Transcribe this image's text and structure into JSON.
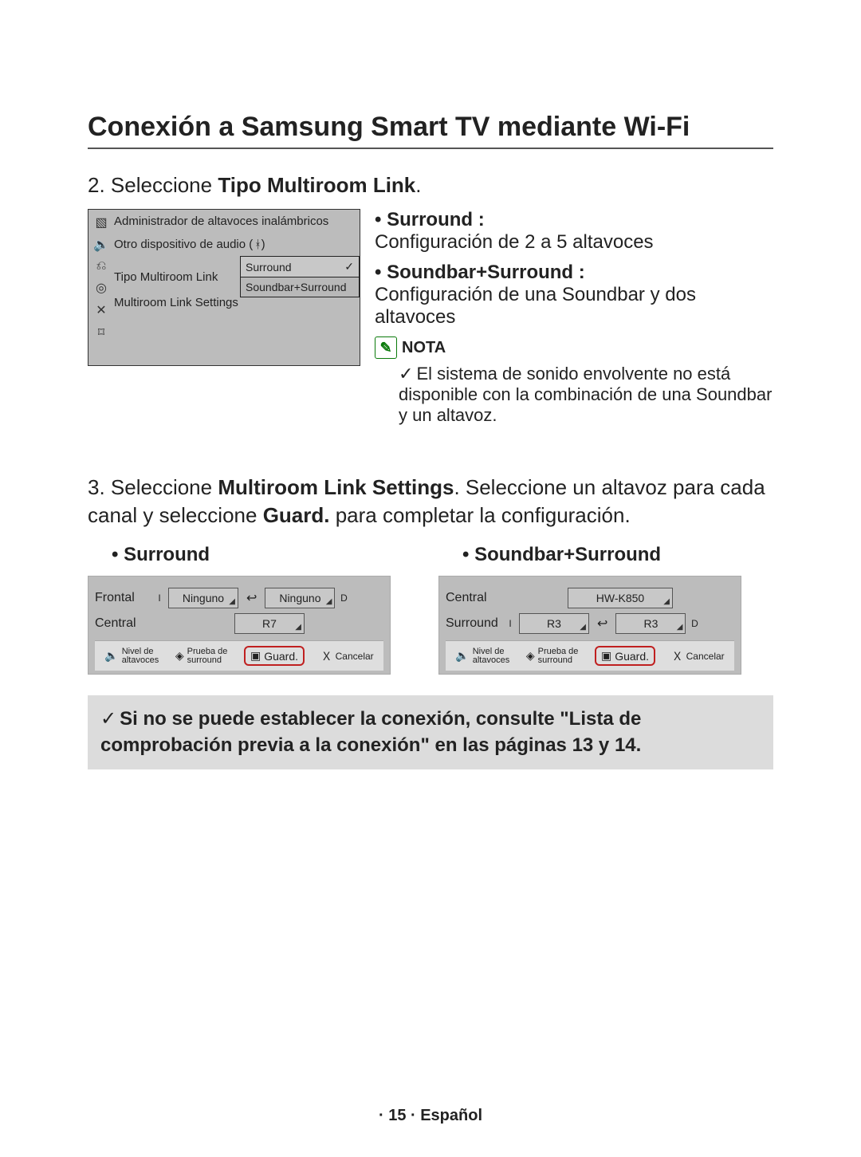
{
  "title": "Conexión a Samsung Smart TV mediante Wi-Fi",
  "step2": {
    "prefix": "2. Seleccione ",
    "bold": "Tipo Multiroom Link",
    "suffix": "."
  },
  "tvmenu": {
    "item1": "Administrador de altavoces inalámbricos",
    "item2_label": "Otro dispositivo de audio (",
    "item2_suffix": ")",
    "item3_label": "Tipo Multiroom Link",
    "item4_label": "Multiroom Link Settings",
    "dd_selected": "Surround",
    "dd_check": "✓",
    "dd_option": "Soundbar+Surround"
  },
  "rightbullets": {
    "b1_title": "Surround :",
    "b1_text": "Configuración de 2 a 5 altavoces",
    "b2_title": "Soundbar+Surround :",
    "b2_text": "Configuración de una Soundbar y dos altavoces",
    "nota_label": "NOTA",
    "nota_body": "El sistema de sonido envolvente no está disponible con la combinación de una Soundbar y un altavoz."
  },
  "step3": {
    "prefix": "3. Seleccione ",
    "bold1": "Multiroom Link Settings",
    "mid": ". Seleccione un altavoz para cada canal y seleccione ",
    "bold2": "Guard.",
    "suffix": " para completar la configuración."
  },
  "cfg_surround": {
    "title": "Surround",
    "frontal": "Frontal",
    "central": "Central",
    "I": "I",
    "D": "D",
    "none": "Ninguno",
    "r7": "R7"
  },
  "cfg_sbsurr": {
    "title": "Soundbar+Surround",
    "central": "Central",
    "surround": "Surround",
    "I": "I",
    "D": "D",
    "hw": "HW-K850",
    "r3": "R3"
  },
  "bar": {
    "nivel1": "Nivel de",
    "nivel2": "altavoces",
    "prueba1": "Prueba de",
    "prueba2": "surround",
    "guard": "Guard.",
    "cancel": "Cancelar"
  },
  "greybox": {
    "text": "Si no se puede establecer la conexión, consulte \"Lista de comprobación previa a la conexión\" en las páginas 13 y 14."
  },
  "footer": "· 15 · Español"
}
